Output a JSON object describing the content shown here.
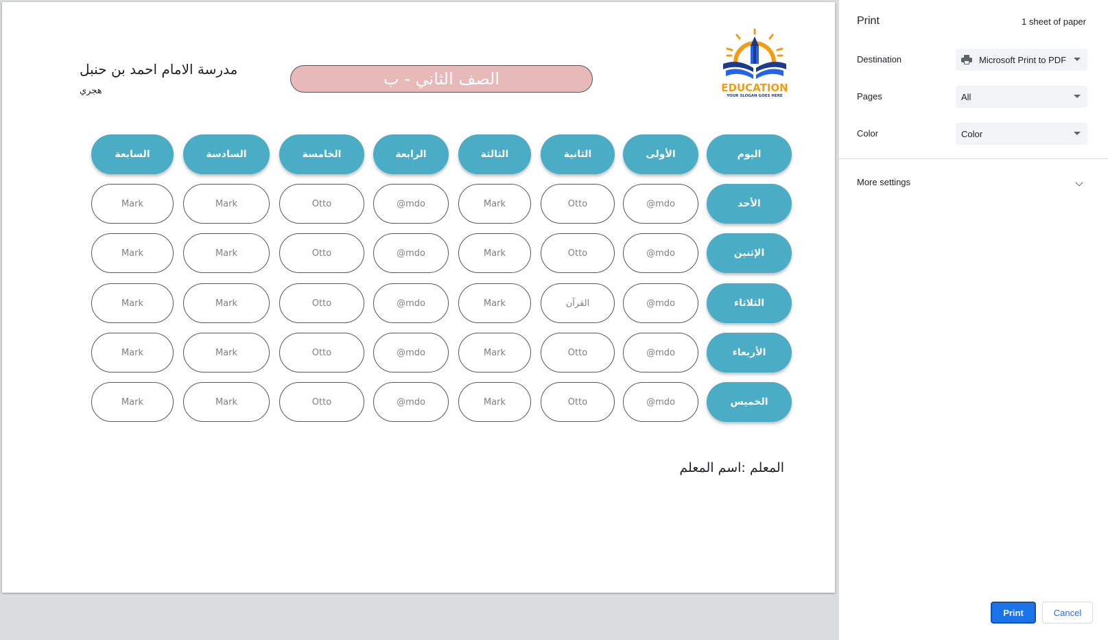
{
  "document": {
    "school_name": "مدرسة الامام احمد بن حنبل",
    "date_label": "هجري",
    "class_title": "الصف الثاني - ب",
    "teacher_label": "المعلم :اسم المعلم",
    "logo": {
      "icon": "education-book-pencil-logo",
      "text": "EDUCATION",
      "slogan": "YOUR SLOGAN GOES HERE",
      "colors": {
        "orange": "#f39c12",
        "navy": "#1e3a8a",
        "blue": "#2563eb"
      }
    },
    "schedule": {
      "header": [
        "اليوم",
        "الأولى",
        "الثانية",
        "الثالثة",
        "الرابعة",
        "الخامسة",
        "السادسة",
        "السابعة"
      ],
      "rows": [
        {
          "day": "الأحد",
          "cells": [
            "@mdo",
            "Otto",
            "Mark",
            "@mdo",
            "Otto",
            "Mark",
            "Mark"
          ]
        },
        {
          "day": "الإثنين",
          "cells": [
            "@mdo",
            "Otto",
            "Mark",
            "@mdo",
            "Otto",
            "Mark",
            "Mark"
          ]
        },
        {
          "day": "الثلاثاء",
          "cells": [
            "@mdo",
            "القرآن",
            "Mark",
            "@mdo",
            "Otto",
            "Mark",
            "Mark"
          ]
        },
        {
          "day": "الأربعاء",
          "cells": [
            "@mdo",
            "Otto",
            "Mark",
            "@mdo",
            "Otto",
            "Mark",
            "Mark"
          ]
        },
        {
          "day": "الخميس",
          "cells": [
            "@mdo",
            "Otto",
            "Mark",
            "@mdo",
            "Otto",
            "Mark",
            "Mark"
          ]
        }
      ],
      "colors": {
        "header_bg": "#4bacc6",
        "title_bg": "#e8b9b9"
      }
    }
  },
  "print_panel": {
    "title": "Print",
    "sheets": "1 sheet of paper",
    "destination": {
      "label": "Destination",
      "value": "Microsoft Print to PDF",
      "icon": "printer-icon"
    },
    "pages": {
      "label": "Pages",
      "value": "All"
    },
    "color": {
      "label": "Color",
      "value": "Color"
    },
    "more_settings": "More settings",
    "print_button": "Print",
    "cancel_button": "Cancel",
    "accent": "#1a73e8"
  }
}
